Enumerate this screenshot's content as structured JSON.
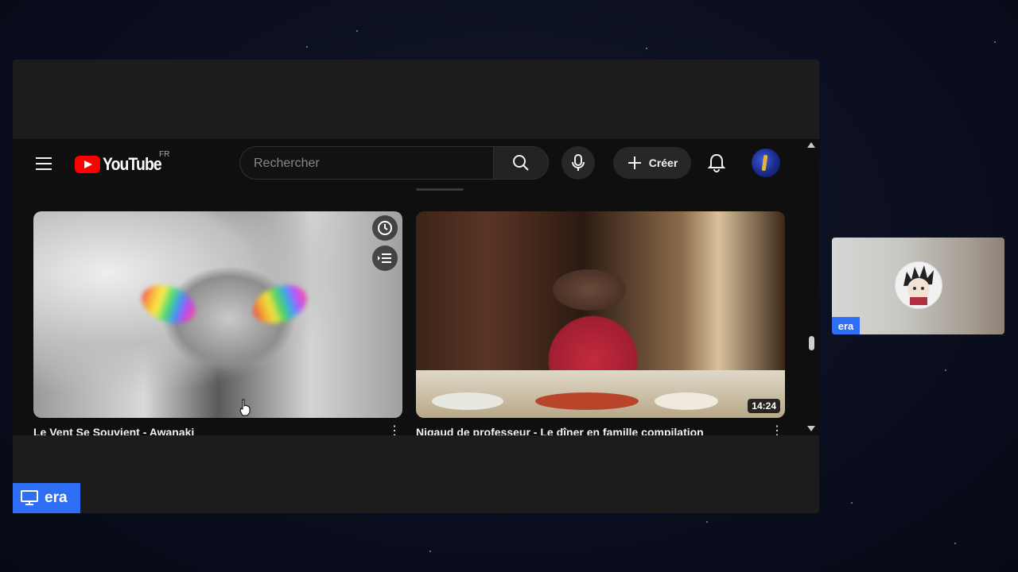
{
  "youtube": {
    "logo_text": "YouTube",
    "country_code": "FR",
    "search_placeholder": "Rechercher",
    "create_label": "Créer",
    "icons": [
      "menu-icon",
      "search-icon",
      "microphone-icon",
      "plus-icon",
      "bell-icon"
    ]
  },
  "videos": [
    {
      "title": "Le Vent Se Souvient - Awanaki",
      "overlay_icons": [
        "watch-later-icon",
        "add-to-queue-icon"
      ]
    },
    {
      "title": "Nigaud de professeur - Le dîner en famille compilation",
      "duration": "14:24"
    }
  ],
  "share": {
    "presenter_label": "era"
  },
  "camera": {
    "participant_label": "era"
  },
  "colors": {
    "youtube_red": "#ff0000",
    "youtube_bg": "#0f0f0f",
    "label_blue": "#2e6ef5"
  }
}
